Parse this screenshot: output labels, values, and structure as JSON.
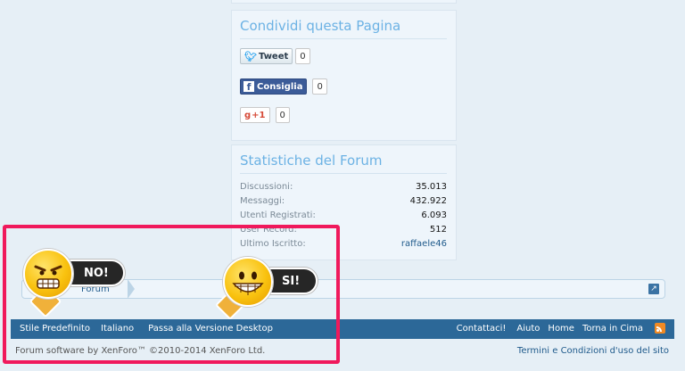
{
  "share": {
    "title": "Condividi questa Pagina",
    "tweet_label": "Tweet",
    "tweet_count": "0",
    "like_label": "Consiglia",
    "like_count": "0",
    "plusone_label": "+1",
    "plusone_count": "0"
  },
  "stats": {
    "title": "Statistiche del Forum",
    "rows": [
      {
        "label": "Discussioni:",
        "value": "35.013"
      },
      {
        "label": "Messaggi:",
        "value": "432.922"
      },
      {
        "label": "Utenti Registrati:",
        "value": "6.093"
      },
      {
        "label": "User Record:",
        "value": "512"
      },
      {
        "label": "Ultimo Iscritto:",
        "value": "raffaele46"
      }
    ]
  },
  "breadcrumb": {
    "items": [
      "Forum"
    ]
  },
  "footer": {
    "left_links": [
      "Stile Predefinito",
      "Italiano",
      "Passa alla Versione Desktop"
    ],
    "right_links": [
      "Contattaci!",
      "Aiuto",
      "Home",
      "Torna in Cima"
    ],
    "copyright": "Forum software by XenForo™ ©2010-2014 XenForo Ltd.",
    "terms": "Termini e Condizioni d'uso del sito"
  },
  "stickers": {
    "no_label": "NO!",
    "yes_label": "SI!"
  },
  "colors": {
    "highlight": "#f0195c",
    "footer_bar": "#2c6898",
    "link": "#1f5a8b",
    "panel_title": "#6cb2e4"
  }
}
